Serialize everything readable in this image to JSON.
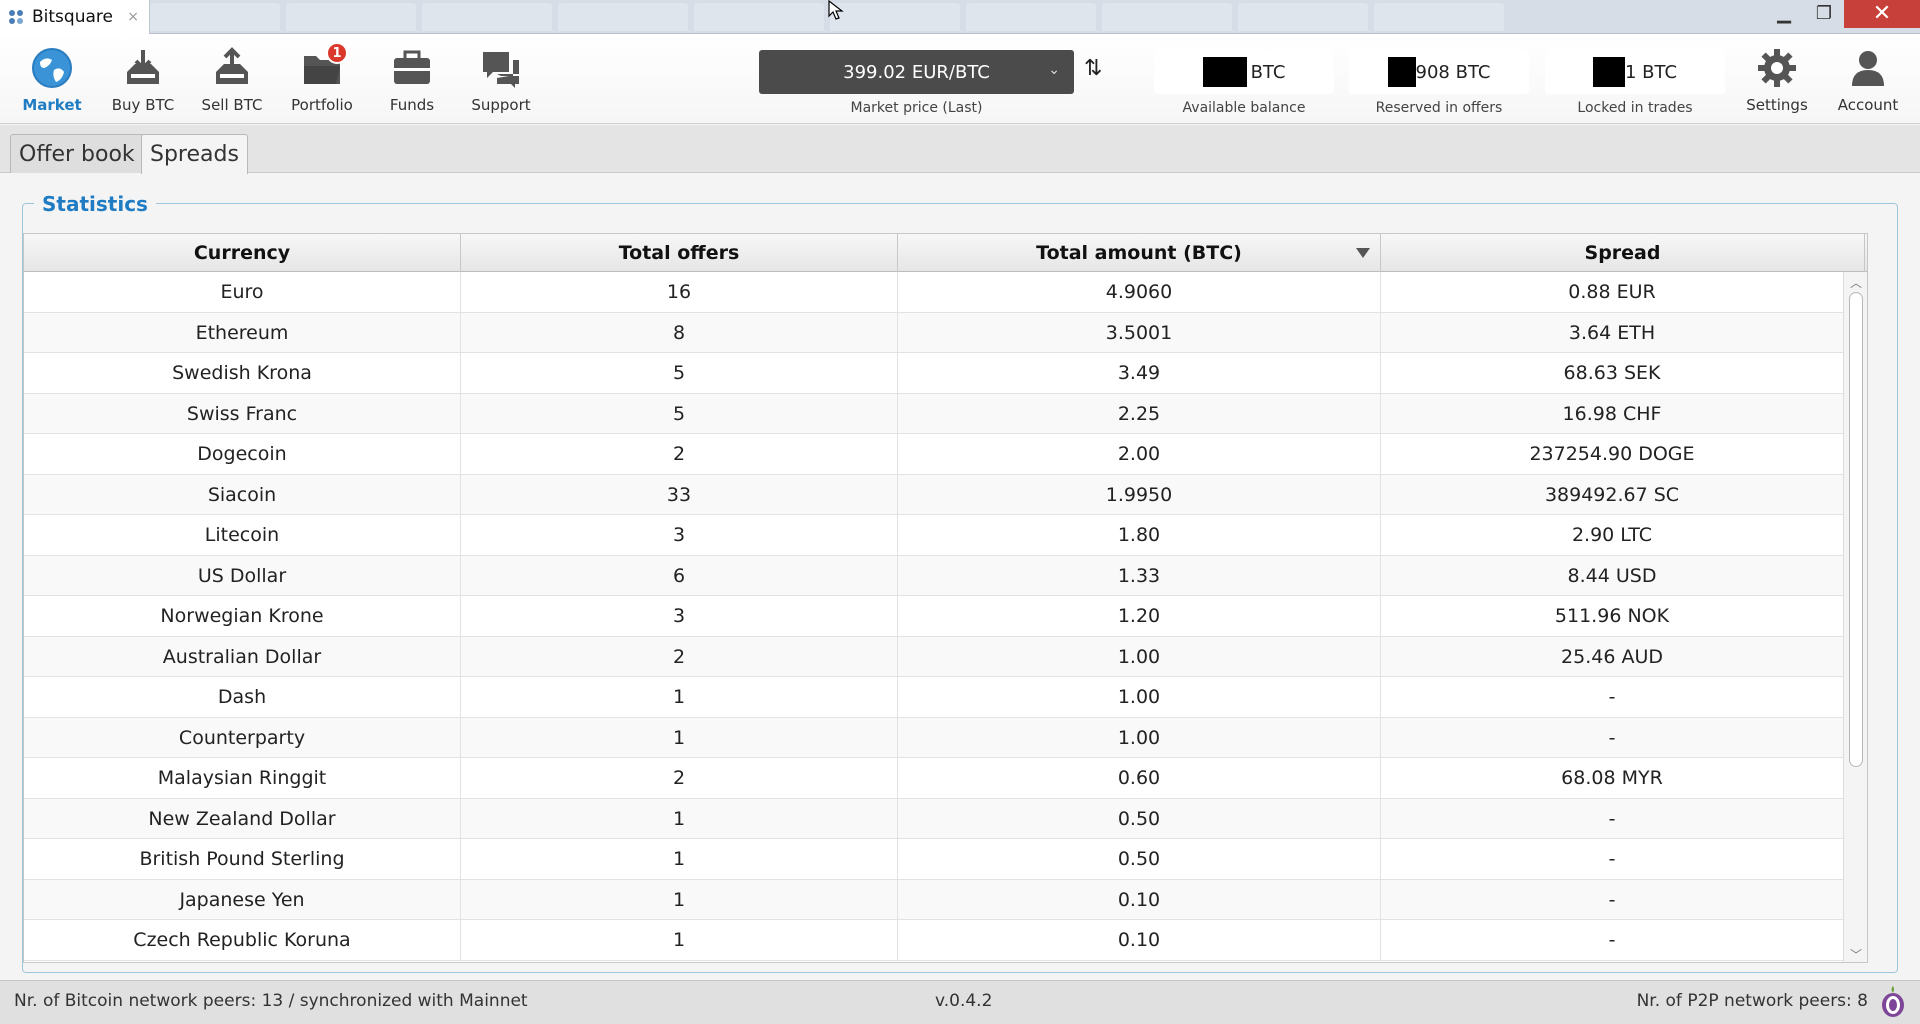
{
  "window": {
    "title": "Bitsquare"
  },
  "nav": {
    "market": "Market",
    "buy": "Buy BTC",
    "sell": "Sell BTC",
    "portfolio": "Portfolio",
    "portfolio_badge": "1",
    "funds": "Funds",
    "support": "Support",
    "settings": "Settings",
    "account": "Account"
  },
  "market_price": {
    "value": "399.02 EUR/BTC",
    "caption": "Market price (Last)"
  },
  "balances": {
    "available": {
      "value": "BTC",
      "caption": "Available balance"
    },
    "reserved": {
      "value": "908 BTC",
      "caption": "Reserved in offers"
    },
    "locked": {
      "value": "1 BTC",
      "caption": "Locked in trades"
    }
  },
  "tabs": {
    "offer_book": "Offer book",
    "spreads": "Spreads"
  },
  "statistics": {
    "title": "Statistics",
    "columns": [
      "Currency",
      "Total offers",
      "Total amount (BTC)",
      "Spread"
    ],
    "rows": [
      [
        "Euro",
        "16",
        "4.9060",
        "0.88 EUR"
      ],
      [
        "Ethereum",
        "8",
        "3.5001",
        "3.64 ETH"
      ],
      [
        "Swedish Krona",
        "5",
        "3.49",
        "68.63 SEK"
      ],
      [
        "Swiss Franc",
        "5",
        "2.25",
        "16.98 CHF"
      ],
      [
        "Dogecoin",
        "2",
        "2.00",
        "237254.90 DOGE"
      ],
      [
        "Siacoin",
        "33",
        "1.9950",
        "389492.67 SC"
      ],
      [
        "Litecoin",
        "3",
        "1.80",
        "2.90 LTC"
      ],
      [
        "US Dollar",
        "6",
        "1.33",
        "8.44 USD"
      ],
      [
        "Norwegian Krone",
        "3",
        "1.20",
        "511.96 NOK"
      ],
      [
        "Australian Dollar",
        "2",
        "1.00",
        "25.46 AUD"
      ],
      [
        "Dash",
        "1",
        "1.00",
        "-"
      ],
      [
        "Counterparty",
        "1",
        "1.00",
        "-"
      ],
      [
        "Malaysian Ringgit",
        "2",
        "0.60",
        "68.08 MYR"
      ],
      [
        "New Zealand Dollar",
        "1",
        "0.50",
        "-"
      ],
      [
        "British Pound Sterling",
        "1",
        "0.50",
        "-"
      ],
      [
        "Japanese Yen",
        "1",
        "0.10",
        "-"
      ],
      [
        "Czech Republic Koruna",
        "1",
        "0.10",
        "-"
      ]
    ]
  },
  "status": {
    "bitcoin_peers": "Nr. of Bitcoin network peers: 13 / synchronized with Mainnet",
    "version": "v.0.4.2",
    "p2p_peers": "Nr. of P2P network peers: 8"
  },
  "colors": {
    "accent": "#1f7cc3",
    "badge": "#d9382a",
    "close": "#c8403a"
  }
}
